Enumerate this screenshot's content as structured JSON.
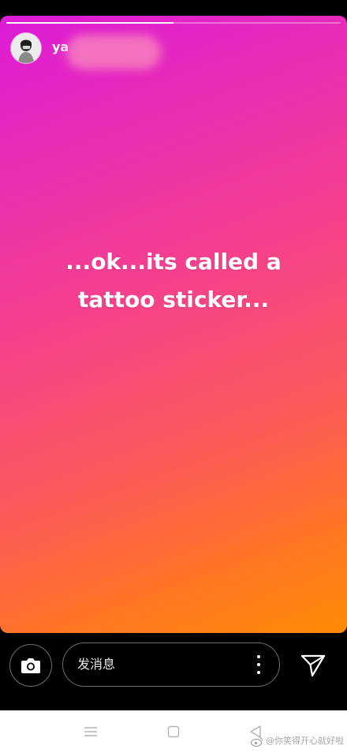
{
  "story": {
    "username": "ya",
    "progress": 0.5,
    "text_lines": [
      "...ok...its called a",
      "tattoo sticker..."
    ],
    "gradient_colors": [
      "#dc1bd8",
      "#f5428a",
      "#ff8a05"
    ]
  },
  "reply_bar": {
    "message_placeholder": "发消息",
    "camera_icon": "camera-icon",
    "more_icon": "more-vertical-icon",
    "send_icon": "send-icon"
  },
  "nav_bar": {
    "icons": [
      "menu-icon",
      "home-square-icon",
      "back-triangle-icon"
    ]
  },
  "watermark": {
    "text": "@你笑得开心就好啦",
    "icon": "weibo-logo-icon"
  }
}
